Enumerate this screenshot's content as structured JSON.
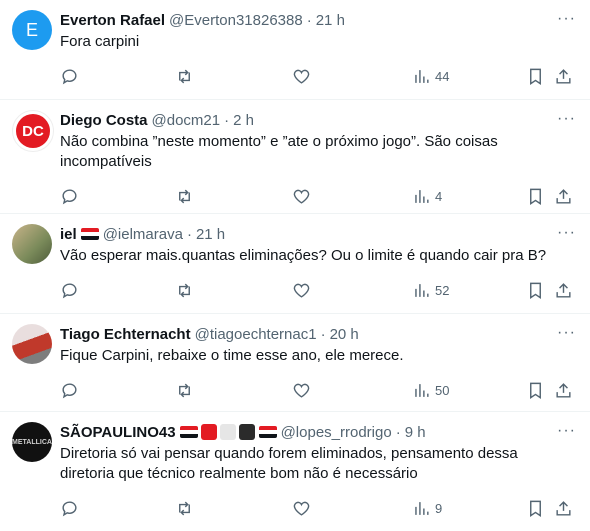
{
  "tweets": [
    {
      "name": "Everton Rafael",
      "handle": "@Everton31826388",
      "time": "21 h",
      "text": "Fora carpini",
      "views": "44",
      "avatar_letter": "E",
      "avatar_color": "#1d9bf0"
    },
    {
      "name": "Diego Costa",
      "handle": "@docm21",
      "time": "2 h",
      "text": "Não combina ”neste momento” e ”ate o próximo jogo”. São coisas incompatíveis",
      "views": "4",
      "avatar_letter": "DC",
      "avatar_color": "#e31b23"
    },
    {
      "name": "iel",
      "handle": "@ielmarava",
      "time": "21 h",
      "text": "Vão esperar mais.quantas eliminações? Ou o limite é quando cair pra B?",
      "views": "52"
    },
    {
      "name": "Tiago Echternacht",
      "handle": "@tiagoechternac1",
      "time": "20 h",
      "text": "Fique Carpini, rebaixe o time esse ano, ele merece.",
      "views": "50"
    },
    {
      "name": "SÃOPAULINO43",
      "handle": "@lopes_rrodrigo",
      "time": "9 h",
      "text": "Diretoria só vai pensar quando forem eliminados, pensamento dessa diretoria que técnico realmente bom não é necessário",
      "views": "9",
      "avatar_letter": "METALLICA"
    }
  ],
  "more_glyph": "···",
  "separator": "·"
}
